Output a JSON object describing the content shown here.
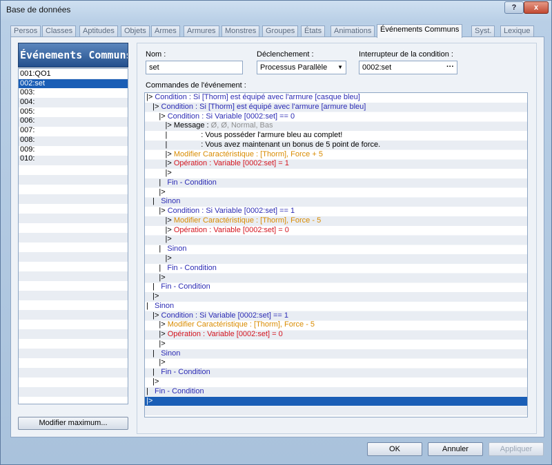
{
  "window": {
    "title": "Base de données",
    "help_label": "?",
    "close_label": "x"
  },
  "tabs": [
    {
      "label": "Persos"
    },
    {
      "label": "Classes"
    },
    {
      "label": "Aptitudes"
    },
    {
      "label": "Objets"
    },
    {
      "label": "Armes"
    },
    {
      "label": "Armures"
    },
    {
      "label": "Monstres"
    },
    {
      "label": "Groupes"
    },
    {
      "label": "États"
    },
    {
      "label": "Animations"
    },
    {
      "label": "Événements Communs",
      "active": true
    },
    {
      "label": "Syst."
    },
    {
      "label": "Lexique"
    }
  ],
  "list": {
    "header": "Événements Communs",
    "items": [
      "001:QO1",
      "002:set",
      "003:",
      "004:",
      "005:",
      "006:",
      "007:",
      "008:",
      "009:",
      "010:"
    ],
    "selected_index": 1,
    "modify_button": "Modifier maximum..."
  },
  "form": {
    "name_label": "Nom :",
    "name_value": "set",
    "trigger_label": "Déclenchement :",
    "trigger_value": "Processus Parallèle",
    "switch_label": "Interrupteur de la condition :",
    "switch_value": "0002:set",
    "commands_label": "Commandes de l'événement :"
  },
  "commands": [
    {
      "prefix": "|> ",
      "text": "Condition : Si [Thorm] est équipé avec l'armure [casque bleu]",
      "color": "blue"
    },
    {
      "prefix": "   |> ",
      "text": "Condition : Si [Thorm] est équipé avec l'armure [armure bleu]",
      "color": "blue"
    },
    {
      "prefix": "      |> ",
      "text": "Condition : Si Variable [0002:set] == 0",
      "color": "blue"
    },
    {
      "prefix": "         |> Message : ",
      "text": "Ø, Ø, Normal, Bas",
      "color": "gray"
    },
    {
      "prefix": "         |                : ",
      "text": "Vous posséder l'armure bleu au complet!",
      "color": "black"
    },
    {
      "prefix": "         |                : ",
      "text": "Vous avez maintenant un bonus de 5 point de force.",
      "color": "black"
    },
    {
      "prefix": "         |> ",
      "text": "Modifier Caractéristique : [Thorm], Force + 5",
      "color": "orange"
    },
    {
      "prefix": "         |> ",
      "text": "Opération : Variable [0002:set] = 1",
      "color": "red"
    },
    {
      "prefix": "         |>",
      "text": "",
      "color": "black"
    },
    {
      "prefix": "      |   ",
      "text": "Fin - Condition",
      "color": "blue"
    },
    {
      "prefix": "      |>",
      "text": "",
      "color": "black"
    },
    {
      "prefix": "   |   ",
      "text": "Sinon",
      "color": "blue"
    },
    {
      "prefix": "      |> ",
      "text": "Condition : Si Variable [0002:set] == 1",
      "color": "blue"
    },
    {
      "prefix": "         |> ",
      "text": "Modifier Caractéristique : [Thorm], Force - 5",
      "color": "orange"
    },
    {
      "prefix": "         |> ",
      "text": "Opération : Variable [0002:set] = 0",
      "color": "red"
    },
    {
      "prefix": "         |>",
      "text": "",
      "color": "black"
    },
    {
      "prefix": "      |   ",
      "text": "Sinon",
      "color": "blue"
    },
    {
      "prefix": "         |>",
      "text": "",
      "color": "black"
    },
    {
      "prefix": "      |   ",
      "text": "Fin - Condition",
      "color": "blue"
    },
    {
      "prefix": "      |>",
      "text": "",
      "color": "black"
    },
    {
      "prefix": "   |   ",
      "text": "Fin - Condition",
      "color": "blue"
    },
    {
      "prefix": "   |>",
      "text": "",
      "color": "black"
    },
    {
      "prefix": "|   ",
      "text": "Sinon",
      "color": "blue"
    },
    {
      "prefix": "   |> ",
      "text": "Condition : Si Variable [0002:set] == 1",
      "color": "blue"
    },
    {
      "prefix": "      |> ",
      "text": "Modifier Caractéristique : [Thorm], Force - 5",
      "color": "orange"
    },
    {
      "prefix": "      |> ",
      "text": "Opération : Variable [0002:set] = 0",
      "color": "red"
    },
    {
      "prefix": "      |>",
      "text": "",
      "color": "black"
    },
    {
      "prefix": "   |   ",
      "text": "Sinon",
      "color": "blue"
    },
    {
      "prefix": "      |>",
      "text": "",
      "color": "black"
    },
    {
      "prefix": "   |   ",
      "text": "Fin - Condition",
      "color": "blue"
    },
    {
      "prefix": "   |>",
      "text": "",
      "color": "black"
    },
    {
      "prefix": "|   ",
      "text": "Fin - Condition",
      "color": "blue"
    },
    {
      "prefix": "|>",
      "text": "",
      "color": "black",
      "selected": true
    }
  ],
  "footer": {
    "ok": "OK",
    "cancel": "Annuler",
    "apply": "Appliquer"
  },
  "colors": {
    "selection": "#1a5eb6",
    "condition_blue": "#2b2bb4",
    "modifier_orange": "#d98b00",
    "operation_red": "#d4141e",
    "message_gray": "#8f8f8f"
  }
}
